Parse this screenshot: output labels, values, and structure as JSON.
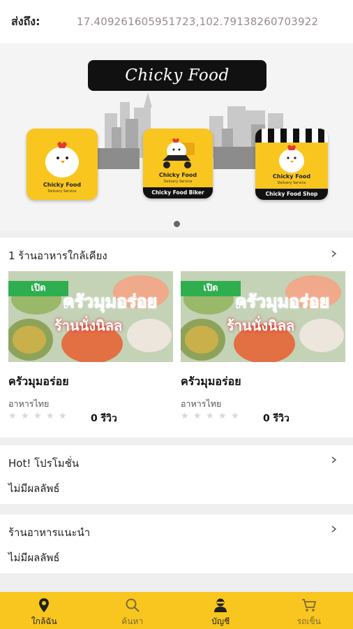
{
  "header": {
    "deliver_label": "ส่งถึง:",
    "coordinates": "17.409261605951723,102.79138260703922"
  },
  "banner": {
    "brand_title": "Chicky Food",
    "cards": [
      {
        "title": "Chicky Food",
        "subtitle": "Delivery Service",
        "strip": ""
      },
      {
        "title": "Chicky Food",
        "subtitle": "Delivery Service",
        "strip": "Chicky Food  Biker"
      },
      {
        "title": "Chicky Food",
        "subtitle": "Delivery Service",
        "strip": "Chicky Food  Shop"
      }
    ],
    "brand_color": "#f9c61f"
  },
  "nearby": {
    "title": "1 ร้านอาหารใกล้เคียง",
    "shops": [
      {
        "badge": "เปิด",
        "image_title": "ครัวมุมอร่อย",
        "image_subtitle": "ร้านนั่งนิลล",
        "name": "ครัวมุมอร่อย",
        "category": "อาหารไทย",
        "rating": 0,
        "reviews": "0 รีวิว"
      },
      {
        "badge": "เปิด",
        "image_title": "ครัวมุมอร่อย",
        "image_subtitle": "ร้านนั่งนิลล",
        "name": "ครัวมุมอร่อย",
        "category": "อาหารไทย",
        "rating": 0,
        "reviews": "0 รีวิว"
      }
    ]
  },
  "promo": {
    "title": "Hot! โปรโมชั่น",
    "empty": "ไม่มีผลลัพธ์"
  },
  "recommend": {
    "title": "ร้านอาหารแนะนำ",
    "empty": "ไม่มีผลลัพธ์"
  },
  "bottom_nav": {
    "items": [
      {
        "label": "ใกล้ฉัน",
        "icon": "location-pin-icon",
        "active": true
      },
      {
        "label": "ค้นหา",
        "icon": "search-icon",
        "active": false
      },
      {
        "label": "บัญชี",
        "icon": "user-icon",
        "active": true
      },
      {
        "label": "รถเข็น",
        "icon": "cart-icon",
        "active": false
      }
    ],
    "color": "#f8c61e"
  }
}
